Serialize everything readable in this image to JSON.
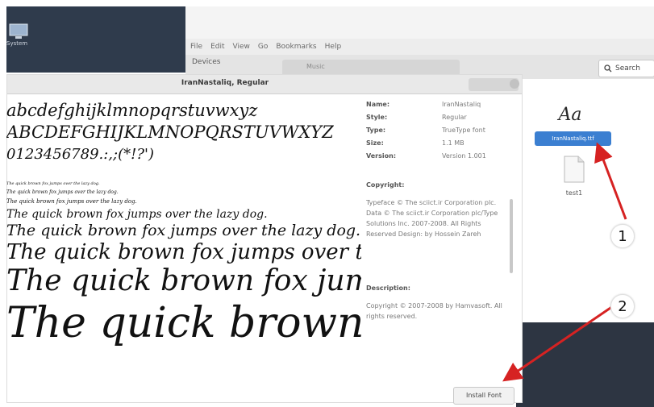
{
  "desktop": {
    "icon_label": "System",
    "icon_name": "computer-icon"
  },
  "file_manager": {
    "menu": [
      "File",
      "Edit",
      "View",
      "Go",
      "Bookmarks",
      "Help"
    ],
    "sidebar_heading": "Devices",
    "path_item": "Music",
    "search_label": "Search",
    "files": [
      {
        "icon": "font-file-icon",
        "icon_text": "Aa",
        "name": "IranNastaliq.ttf",
        "selected": true
      },
      {
        "icon": "text-file-icon",
        "name": "test1",
        "selected": false
      }
    ]
  },
  "font_viewer": {
    "title": "IranNastaliq, Regular",
    "preview": {
      "lowercase": "abcdefghijklmnopqrstuvwxyz",
      "uppercase": "ABCDEFGHIJKLMNOPQRSTUVWXYZ",
      "digits": "0123456789.:,;(*!?')",
      "pangram": "The quick brown fox jumps over the lazy dog."
    },
    "info": {
      "name_label": "Name:",
      "name_value": "IranNastaliq",
      "style_label": "Style:",
      "style_value": "Regular",
      "type_label": "Type:",
      "type_value": "TrueType font",
      "size_label": "Size:",
      "size_value": "1.1 MB",
      "version_label": "Version:",
      "version_value": "Version 1.001",
      "copyright_label": "Copyright:",
      "copyright_text": "Typeface © The sciict.ir Corporation plc. Data © The sciict.ir Corporation plc/Type Solutions Inc. 2007-2008. All Rights Reserved Design: by Hossein Zareh",
      "description_label": "Description:",
      "description_text": "Copyright © 2007-2008 by Hamvasoft. All rights reserved."
    },
    "install_button": "Install Font"
  },
  "annotations": {
    "callout_1": "1",
    "callout_2": "2",
    "arrow_color": "#d62222"
  },
  "colors": {
    "selection": "#3b7fd1",
    "desktop_dark": "#2f3b4c"
  }
}
